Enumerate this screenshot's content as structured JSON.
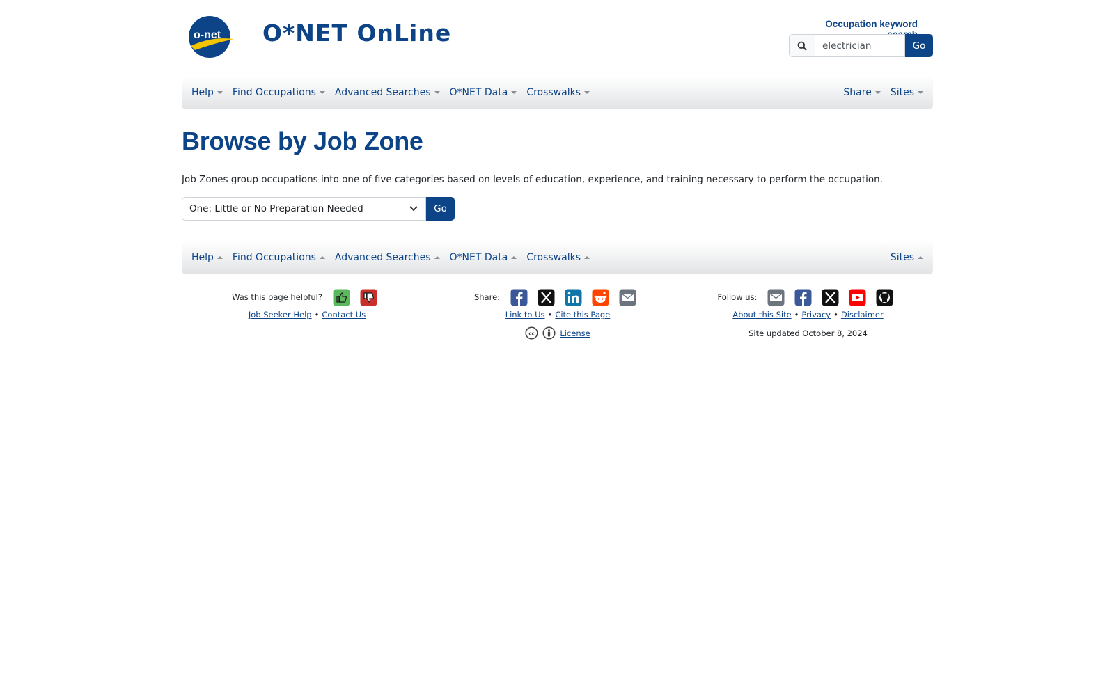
{
  "header": {
    "logo_text": "o-net",
    "site_title": "O*NET OnLine",
    "search": {
      "label": "Occupation keyword search",
      "value": "electrician",
      "go_label": "Go"
    }
  },
  "nav_top": {
    "left": [
      "Help",
      "Find Occupations",
      "Advanced Searches",
      "O*NET Data",
      "Crosswalks"
    ],
    "right": [
      "Share",
      "Sites"
    ]
  },
  "main": {
    "title": "Browse by Job Zone",
    "intro": "Job Zones group occupations into one of five categories based on levels of education, experience, and training necessary to perform the occupation.",
    "select_value": "One: Little or No Preparation Needed",
    "go_label": "Go"
  },
  "nav_bottom": {
    "left": [
      "Help",
      "Find Occupations",
      "Advanced Searches",
      "O*NET Data",
      "Crosswalks"
    ],
    "right": [
      "Sites"
    ]
  },
  "footer": {
    "helpful_label": "Was this page helpful?",
    "helpful_links": [
      "Job Seeker Help",
      "Contact Us"
    ],
    "share_label": "Share:",
    "share_links": [
      "Link to Us",
      "Cite this Page"
    ],
    "license_label": "License",
    "follow_label": "Follow us:",
    "follow_links": [
      "About this Site",
      "Privacy",
      "Disclaimer"
    ],
    "updated": "Site updated October 8, 2024"
  },
  "colors": {
    "brand_blue": "#0d4488",
    "thumbs_up_green": "#5cb85c",
    "thumbs_down_red": "#c9302c",
    "facebook": "#3b5998",
    "linkedin": "#0e76a8",
    "reddit": "#ff4500",
    "youtube": "#ff0000"
  }
}
